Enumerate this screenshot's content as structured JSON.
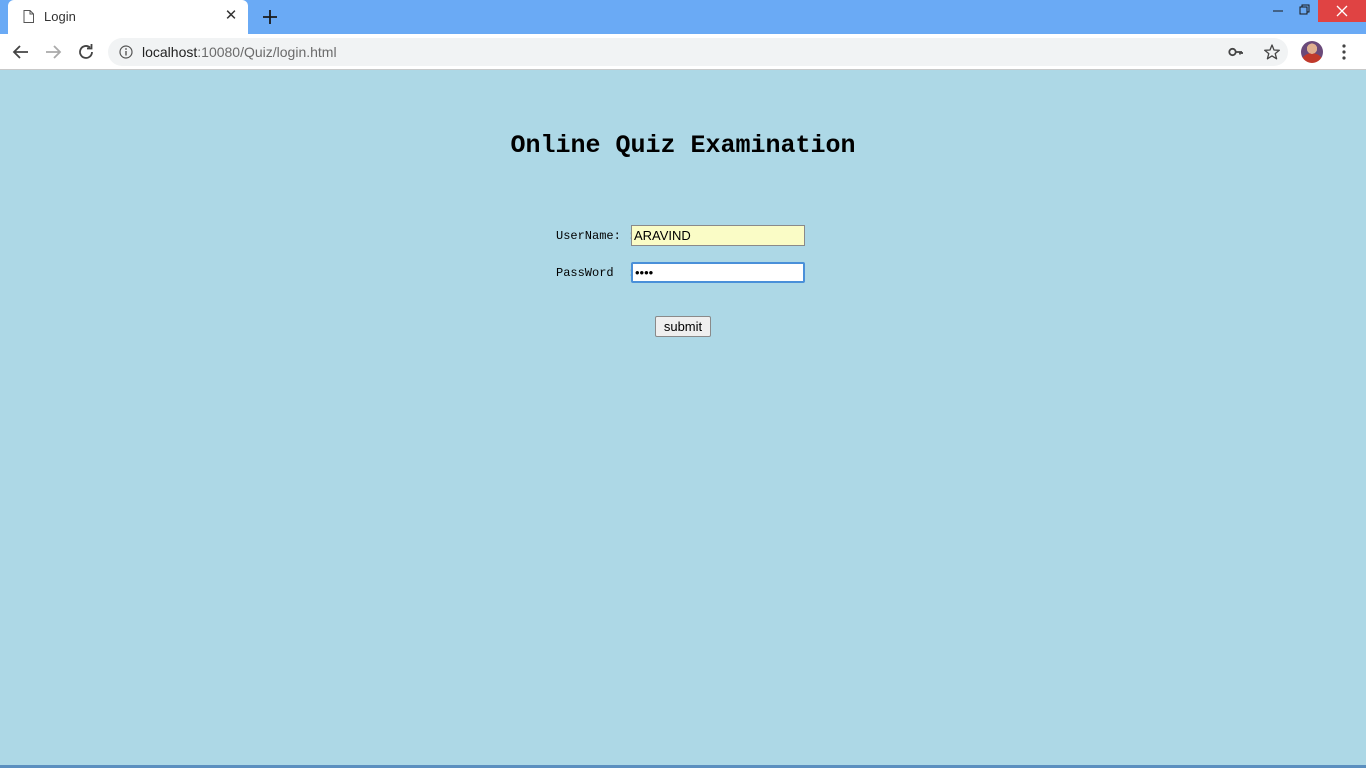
{
  "browser": {
    "tab_title": "Login",
    "tab_close_glyph": "✕",
    "url_host": "localhost",
    "url_rest": ":10080/Quiz/login.html",
    "icons": [
      "page-icon",
      "new-tab-icon",
      "minimize-icon",
      "restore-icon",
      "window-close-icon",
      "back-icon",
      "forward-icon",
      "reload-icon",
      "info-icon",
      "key-icon",
      "star-icon",
      "avatar",
      "more-menu-icon"
    ],
    "colors": {
      "titlebar": "#6aaaf5",
      "close": "#e04343"
    }
  },
  "page": {
    "heading": "Online Quiz Examination",
    "username_label": "UserName: :",
    "password_label": "PassWord  :",
    "username_value": "ARAVIND",
    "password_value": "••••",
    "submit_label": "submit",
    "colors": {
      "background": "#add8e6",
      "autofill": "#fafcc6"
    }
  }
}
